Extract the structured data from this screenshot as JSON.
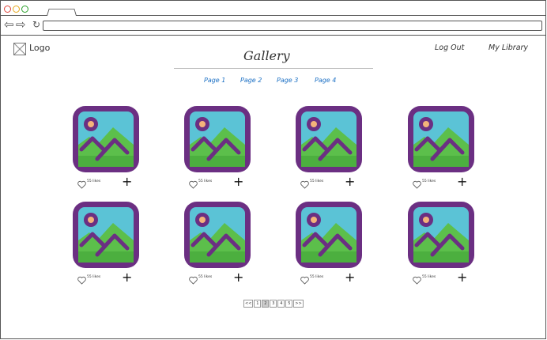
{
  "browser": {
    "back_icon": "back-arrow-icon",
    "forward_icon": "forward-arrow-icon",
    "reload_icon": "reload-icon"
  },
  "header": {
    "logo": "Logo",
    "title": "Gallery",
    "logout": "Log Out",
    "library": "My Library"
  },
  "pages": [
    "Page 1",
    "Page 2",
    "Page 3",
    "Page 4"
  ],
  "gallery": {
    "likes_label": "55 likes",
    "plus_label": "+",
    "colors": {
      "frame": "#6b2f82",
      "sky": "#5bc3d6",
      "grass": "#5cbf4b",
      "grass_dark": "#4caf3f",
      "sun": "#f4b37a"
    }
  },
  "pagination": [
    "<<",
    "1",
    "2",
    "3",
    "4",
    "5",
    ">>"
  ],
  "pagination_active": "2"
}
